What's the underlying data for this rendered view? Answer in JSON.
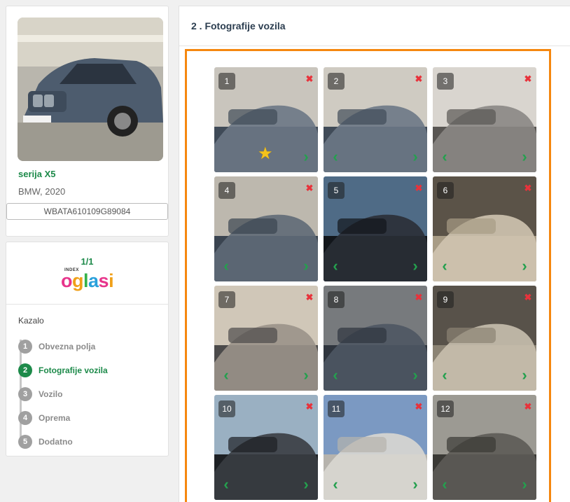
{
  "vehicle": {
    "title": "serija X5",
    "subtitle": "BMW, 2020",
    "vin": "WBATA610109G89084"
  },
  "ad_counter": "1/1",
  "logo": {
    "small_text": "INDEX",
    "main_text": "oglasi"
  },
  "toc": {
    "heading": "Kazalo",
    "items": [
      {
        "num": "1",
        "label": "Obvezna polja"
      },
      {
        "num": "2",
        "label": "Fotografije vozila"
      },
      {
        "num": "3",
        "label": "Vozilo"
      },
      {
        "num": "4",
        "label": "Oprema"
      },
      {
        "num": "5",
        "label": "Dodatno"
      }
    ],
    "active_index": 1
  },
  "section": {
    "title": "2 . Fotografije vozila"
  },
  "photos": [
    {
      "num": "1",
      "main": true
    },
    {
      "num": "2"
    },
    {
      "num": "3"
    },
    {
      "num": "4"
    },
    {
      "num": "5"
    },
    {
      "num": "6"
    },
    {
      "num": "7"
    },
    {
      "num": "8"
    },
    {
      "num": "9"
    },
    {
      "num": "10"
    },
    {
      "num": "11"
    },
    {
      "num": "12"
    }
  ],
  "icons": {
    "delete": "close-icon",
    "prev": "chevron-left-icon",
    "next": "chevron-right-icon",
    "main_photo": "star-icon"
  },
  "colors": {
    "accent_green": "#1d8a4a",
    "frame_orange": "#f5870f",
    "delete_red": "#e8323b",
    "arrow_green": "#24a04e"
  }
}
